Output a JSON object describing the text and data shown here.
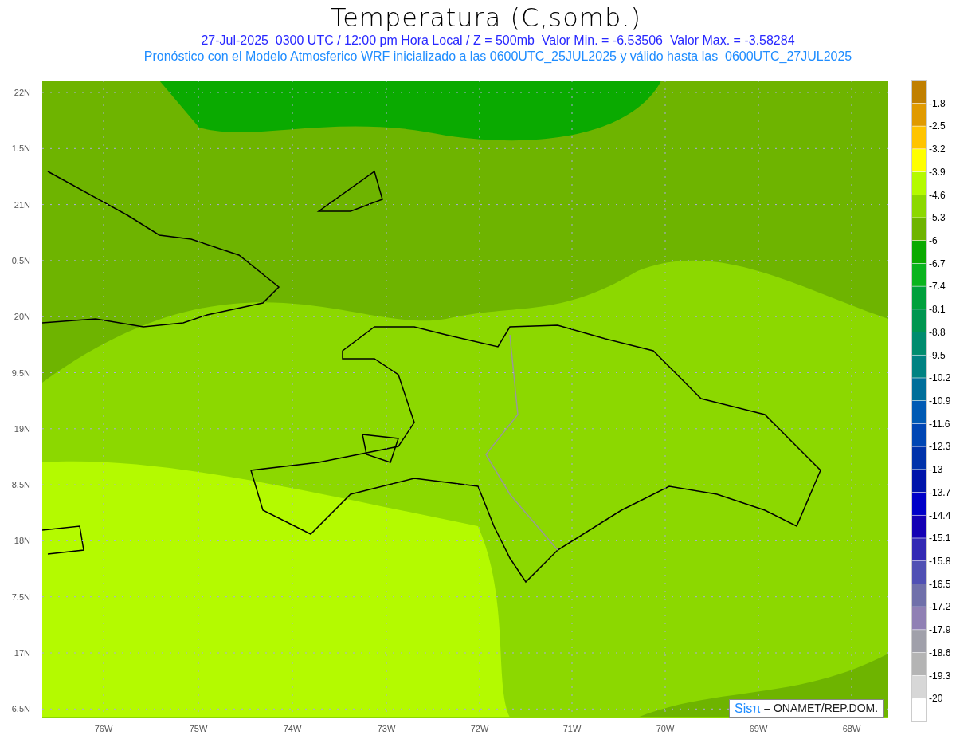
{
  "title": "Temperatura (C,somb.)",
  "subtitle": "27-Jul-2025  0300 UTC / 12:00 pm Hora Local / Z = 500mb  Valor Min. = -6.53506  Valor Max. = -3.58284",
  "description": "Pronóstico con el Modelo Atmosferico WRF inicializado a las 0600UTC_25JUL2025 y válido hasta las  0600UTC_27JUL2025",
  "map": {
    "lat_labels": [
      "22N",
      "1.5N",
      "21N",
      "0.5N",
      "20N",
      "9.5N",
      "19N",
      "8.5N",
      "18N",
      "7.5N",
      "17N",
      "6.5N"
    ],
    "lon_labels": [
      "76W",
      "75W",
      "74W",
      "73W",
      "72W",
      "71W",
      "70W",
      "69W",
      "68W"
    ],
    "credit": {
      "logo": "Sisπ",
      "text": "– ONAMET/REP.DOM."
    }
  },
  "colorbar": {
    "boxes": [
      {
        "color": "#c07f00"
      },
      {
        "color": "#e09a00"
      },
      {
        "color": "#ffc400"
      },
      {
        "color": "#ffff00"
      },
      {
        "color": "#b4fa00"
      },
      {
        "color": "#8cd800"
      },
      {
        "color": "#6eb400"
      },
      {
        "color": "#0aaa00"
      },
      {
        "color": "#0ab41e"
      },
      {
        "color": "#00a03c"
      },
      {
        "color": "#009650"
      },
      {
        "color": "#008c6e"
      },
      {
        "color": "#008282"
      },
      {
        "color": "#006e9a"
      },
      {
        "color": "#005ab4"
      },
      {
        "color": "#0046b4"
      },
      {
        "color": "#0032aa"
      },
      {
        "color": "#0014aa"
      },
      {
        "color": "#0000c8"
      },
      {
        "color": "#1400b4"
      },
      {
        "color": "#3228b4"
      },
      {
        "color": "#5050b4"
      },
      {
        "color": "#7070aa"
      },
      {
        "color": "#9080b4"
      },
      {
        "color": "#a0a0aa"
      },
      {
        "color": "#b4b4b4"
      },
      {
        "color": "#d7d7d7"
      },
      {
        "color": "#ffffff"
      }
    ],
    "labels": [
      "-1.8",
      "-2.5",
      "-3.2",
      "-3.9",
      "-4.6",
      "-5.3",
      "-6",
      "-6.7",
      "-7.4",
      "-8.1",
      "-8.8",
      "-9.5",
      "-10.2",
      "-10.9",
      "-11.6",
      "-12.3",
      "-13",
      "-13.7",
      "-14.4",
      "-15.1",
      "-15.8",
      "-16.5",
      "-17.2",
      "-17.9",
      "-18.6",
      "-19.3",
      "-20"
    ]
  }
}
